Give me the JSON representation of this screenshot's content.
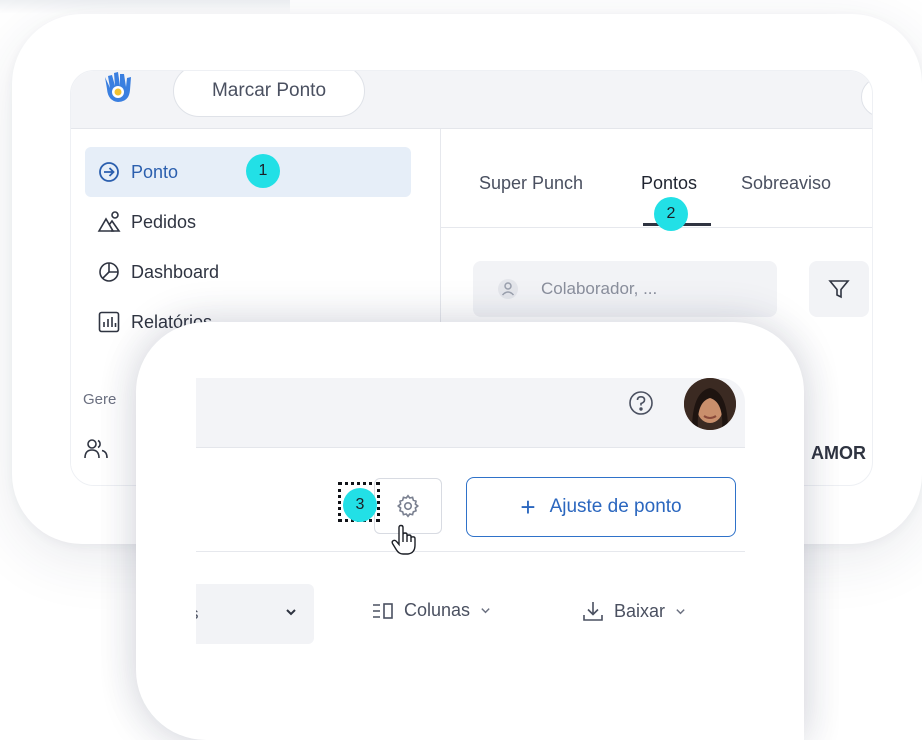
{
  "header": {
    "clock_button_label": "Marcar Ponto"
  },
  "sidebar": {
    "items": [
      {
        "label": "Ponto",
        "icon": "arrow-circle-icon",
        "active": true
      },
      {
        "label": "Pedidos",
        "icon": "shapes-icon"
      },
      {
        "label": "Dashboard",
        "icon": "pie-chart-icon"
      },
      {
        "label": "Relatórios",
        "icon": "bar-chart-icon"
      }
    ],
    "section_label": "Gere"
  },
  "tabs": [
    {
      "label": "Super Punch"
    },
    {
      "label": "Pontos",
      "active": true
    },
    {
      "label": "Sobreaviso"
    }
  ],
  "filter": {
    "placeholder": "Colaborador, ..."
  },
  "table": {
    "visible_header_fragment": "AMOR"
  },
  "steps": [
    "1",
    "2",
    "3"
  ],
  "actions": {
    "adjust_label": "Ajuste de ponto",
    "adjust_plus": "+"
  },
  "toolbar": {
    "select_value": "s",
    "columns_label": "Colunas",
    "download_label": "Baixar"
  },
  "colors": {
    "accent": "#2b67bf",
    "badge": "#22e0e6",
    "active_bg": "#e6eef8",
    "surface": "#f2f3f6"
  }
}
